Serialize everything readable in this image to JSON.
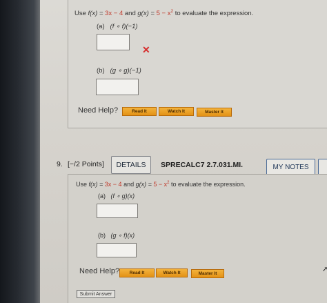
{
  "q8": {
    "prompt": {
      "use": "Use",
      "f_lhs": "f(x) = ",
      "f_rhs": "3x − 4",
      "and": "and",
      "g_lhs": "g(x) = ",
      "g_rhs": "5 − x",
      "g_exp": "2",
      "tail": "to evaluate the expression."
    },
    "part_a": {
      "letter": "(a)",
      "expr": "(f ∘ f)(−1)",
      "result": "incorrect"
    },
    "part_b": {
      "letter": "(b)",
      "expr": "(g ∘ g)(−1)"
    },
    "help": {
      "label": "Need Help?",
      "read": "Read It",
      "watch": "Watch It",
      "master": "Master It"
    }
  },
  "q9": {
    "number": "9.",
    "points": "[−/2 Points]",
    "details": "DETAILS",
    "source": "SPRECALC7 2.7.031.MI.",
    "my_notes": "MY NOTES",
    "prompt": {
      "use": "Use",
      "f_lhs": "f(x) = ",
      "f_rhs": "3x − 4",
      "and": "and",
      "g_lhs": "g(x) = ",
      "g_rhs": "5 − x",
      "g_exp": "2",
      "tail": "to evaluate the expression."
    },
    "part_a": {
      "letter": "(a)",
      "expr": "(f ∘ g)(x)"
    },
    "part_b": {
      "letter": "(b)",
      "expr": "(g ∘ f)(x)"
    },
    "help": {
      "label": "Need Help?",
      "read": "Read It",
      "watch": "Watch It",
      "master": "Master It"
    },
    "submit": "Submit Answer"
  },
  "colors": {
    "accent_orange": "#e89a1e",
    "wrong_red": "#d62d2d",
    "link_blue": "#1d3557"
  },
  "icons": {
    "wrong_mark": "✕",
    "cursor": "➚"
  }
}
